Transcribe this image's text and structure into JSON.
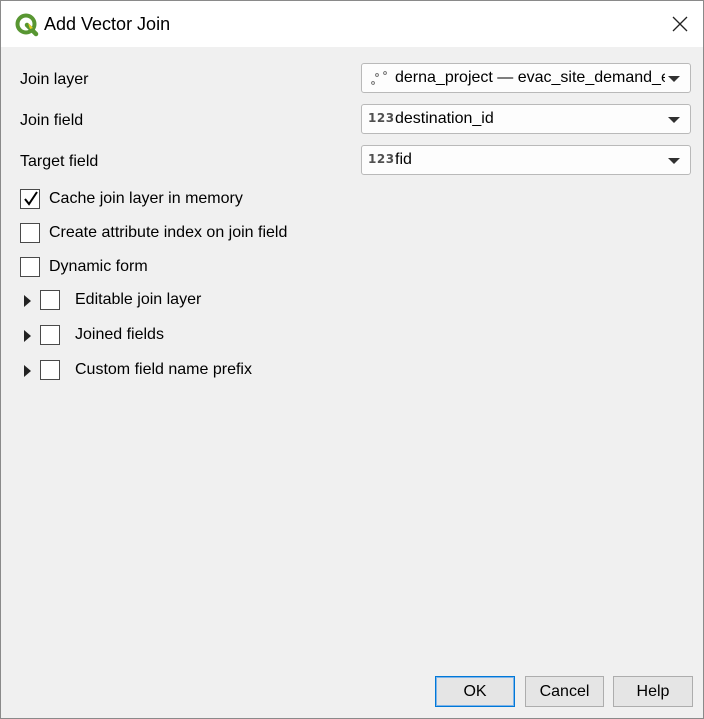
{
  "window": {
    "title": "Add Vector Join"
  },
  "form": {
    "join_layer": {
      "label": "Join layer",
      "value": "derna_project — evac_site_demand_e",
      "icon": "point-layer-icon"
    },
    "join_field": {
      "label": "Join field",
      "value": "destination_id",
      "type_badge": "123"
    },
    "target_field": {
      "label": "Target field",
      "value": "fid",
      "type_badge": "123"
    }
  },
  "options": [
    {
      "label": "Cache join layer in memory",
      "checked": true
    },
    {
      "label": "Create attribute index on join field",
      "checked": false
    },
    {
      "label": "Dynamic form",
      "checked": false
    }
  ],
  "groups": [
    {
      "label": "Editable join layer",
      "checked": false,
      "expanded": false
    },
    {
      "label": "Joined fields",
      "checked": false,
      "expanded": false
    },
    {
      "label": "Custom field name prefix",
      "checked": false,
      "expanded": false
    }
  ],
  "buttons": {
    "ok": "OK",
    "cancel": "Cancel",
    "help": "Help"
  },
  "colors": {
    "qgis_green": "#589632",
    "qgis_yellow": "#f0d022",
    "default_button_border": "#0078d7"
  }
}
